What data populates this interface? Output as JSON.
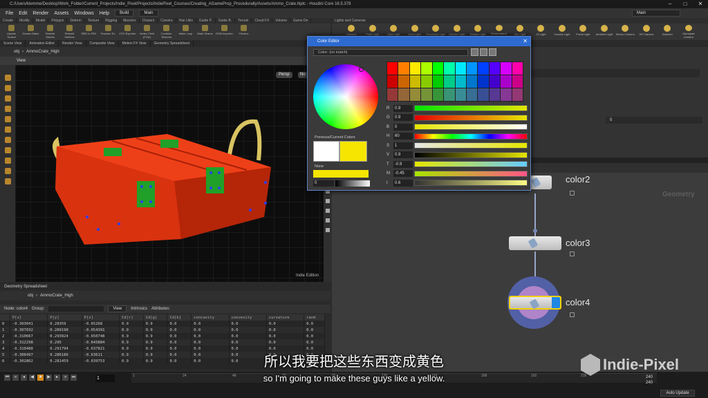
{
  "window": {
    "title": "C:/Users/klemme/Desktop/Work_Folder/Current_Projects/Indie_Pixel/Projects/IndiePixel_Courses/Creating_AGameProp_Procedurally/Assets/Ammo_Crate.hiplc - Houdini Core 16.5.378"
  },
  "menu": [
    "File",
    "Edit",
    "Render",
    "Assets",
    "Windows",
    "Help"
  ],
  "desktops": {
    "build": "Build",
    "main": "Main",
    "main_right": "Main"
  },
  "shelf_tabs": [
    "Create",
    "Modify",
    "Model",
    "Polygon",
    "Deform",
    "Texture",
    "Rigging",
    "Muscles",
    "Charact",
    "Constra",
    "Hair Utils",
    "Guide P.",
    "Guide B.",
    "Terrain",
    "Cloud FX",
    "Volume",
    "Game De"
  ],
  "shelf_tools": [
    "Update Toolset",
    "Games Baker",
    "Rebuild Sheets",
    "Rebuild Vertices",
    "RBD to FBX",
    "Fracture Ex.",
    "CSV Exporter",
    "Vertex Field (FGA)",
    "Combine Textures",
    "Make Loop",
    "Mark Seams",
    "DSM Importer",
    "Flexbox"
  ],
  "lights_tab": "Lights and Cameras",
  "lights_tools": [
    "Camera",
    "Point Light",
    "Spot Light",
    "Area Light",
    "Geometry Light",
    "Volume Light",
    "Distant Light",
    "Environment Light",
    "Sky Light",
    "GI Light",
    "Caustic Light",
    "Portal Light",
    "Ambient Light",
    "Stereo Camera",
    "VR Camera",
    "Switcher",
    "Gamepad Camera"
  ],
  "pane_tabs": [
    "Scene View",
    "Animation Editor",
    "Render View",
    "Composite View",
    "Motion FX View",
    "Geometry Spreadsheet"
  ],
  "path": {
    "root": "obj",
    "node": "AmmoCrate_High"
  },
  "viewport": {
    "label": "View",
    "persp": "Persp",
    "cam": "No",
    "edition": "Indie Edition"
  },
  "color_editor": {
    "title": "Color Editor",
    "match": "Color: (no match)",
    "prev_current": "Previous/Current Colors",
    "none_label": "None",
    "alpha": "0",
    "channels": [
      {
        "k": "R",
        "v": "0.9"
      },
      {
        "k": "G",
        "v": "0.9"
      },
      {
        "k": "B",
        "v": "0"
      },
      {
        "k": "H",
        "v": "60"
      },
      {
        "k": "S",
        "v": "1"
      },
      {
        "k": "V",
        "v": "0.9"
      },
      {
        "k": "T",
        "v": "-0.9"
      },
      {
        "k": "M",
        "v": "-0.45"
      },
      {
        "k": "I",
        "v": "0.6"
      }
    ]
  },
  "sheet": {
    "tab": "Geometry Spreadsheet",
    "node_label": "Node: color4",
    "group_label": "Group:",
    "view_label": "View",
    "intrinsics": "Intrinsics",
    "attributes_label": "Attributes:",
    "columns": [
      "",
      "P[x]",
      "P[y]",
      "P[z]",
      "Cd[r]",
      "Cd[g]",
      "Cd[b]",
      "concavity",
      "convexity",
      "curvature",
      "rand"
    ],
    "rows": [
      [
        "0",
        "-0.303041",
        "0.28359",
        "-0.65268",
        "0.9",
        "0.9",
        "0.0",
        "0.0",
        "0.0",
        "0.0",
        "0.0"
      ],
      [
        "1",
        "-0.307032",
        "0.289198",
        "-0.654391",
        "0.9",
        "0.9",
        "0.0",
        "0.0",
        "0.0",
        "0.0",
        "0.0"
      ],
      [
        "2",
        "-0.310667",
        "0.293924",
        "-0.650748",
        "0.9",
        "0.9",
        "0.0",
        "0.0",
        "0.0",
        "0.0",
        "0.0"
      ],
      [
        "3",
        "-0.312298",
        "0.295",
        "-0.643884",
        "0.9",
        "0.9",
        "0.0",
        "0.0",
        "0.0",
        "0.0",
        "0.0"
      ],
      [
        "4",
        "-0.310488",
        "0.291794",
        "-0.637821",
        "0.9",
        "0.9",
        "0.0",
        "0.0",
        "0.0",
        "0.0",
        "0.0"
      ],
      [
        "5",
        "-0.306497",
        "0.286186",
        "-0.63611",
        "0.9",
        "0.9",
        "0.0",
        "0.0",
        "0.0",
        "0.0",
        "0.0"
      ],
      [
        "6",
        "-0.302862",
        "0.281459",
        "-0.639753",
        "0.9",
        "0.9",
        "0.0",
        "0.0",
        "0.0",
        "0.0",
        "0.0"
      ]
    ]
  },
  "network": {
    "context_label": "Geometry",
    "nodes": [
      {
        "name": "color2"
      },
      {
        "name": "color3"
      },
      {
        "name": "color4"
      }
    ],
    "param_value": "0"
  },
  "timeline": {
    "frame": "1",
    "start": "1",
    "ticks": [
      "1",
      "24",
      "48",
      "72",
      "96",
      "120",
      "144",
      "168",
      "192",
      "216"
    ],
    "end1": "240",
    "end2": "240",
    "auto_update": "Auto Update"
  },
  "subtitles": {
    "zh": "所以我要把这些东西变成黄色",
    "en": "so I'm going to make these guys like a yellow."
  },
  "watermark": "Indie-Pixel",
  "colors": {
    "accent": "#2d6bd1",
    "yellow": "#f5e500",
    "crate": "#e83a14"
  }
}
